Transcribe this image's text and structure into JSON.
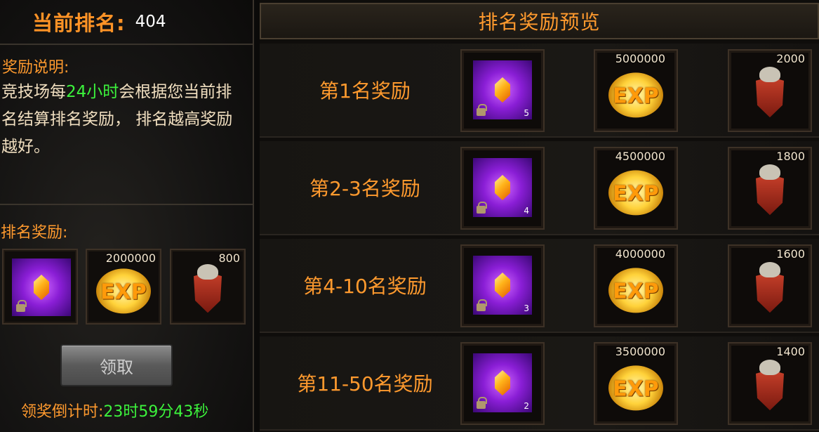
{
  "current_rank": {
    "label": "当前排名:",
    "value": "404"
  },
  "description": {
    "title": "奖励说明:",
    "text_prefix": "竞技场每",
    "text_highlight": "24小时",
    "text_suffix": "会根据您当前排名结算排名奖励， 排名越高奖励越好。"
  },
  "rank_reward": {
    "title": "排名奖励:",
    "items": [
      {
        "icon": "purple-gem-icon",
        "count": ""
      },
      {
        "icon": "exp-icon",
        "amount": "2000000"
      },
      {
        "icon": "honor-badge-icon",
        "amount": "800"
      }
    ]
  },
  "claim_button": "领取",
  "countdown": {
    "label": "领奖倒计时:",
    "value": "23时59分43秒"
  },
  "preview": {
    "title": "排名奖励预览",
    "tiers": [
      {
        "label": "第1名奖励",
        "gem_count": "5",
        "exp": "5000000",
        "honor": "2000"
      },
      {
        "label": "第2-3名奖励",
        "gem_count": "4",
        "exp": "4500000",
        "honor": "1800"
      },
      {
        "label": "第4-10名奖励",
        "gem_count": "3",
        "exp": "4000000",
        "honor": "1600"
      },
      {
        "label": "第11-50名奖励",
        "gem_count": "2",
        "exp": "3500000",
        "honor": "1400"
      }
    ]
  },
  "colors": {
    "accent_orange": "#ff9a2e",
    "highlight_green": "#3cf33c"
  }
}
